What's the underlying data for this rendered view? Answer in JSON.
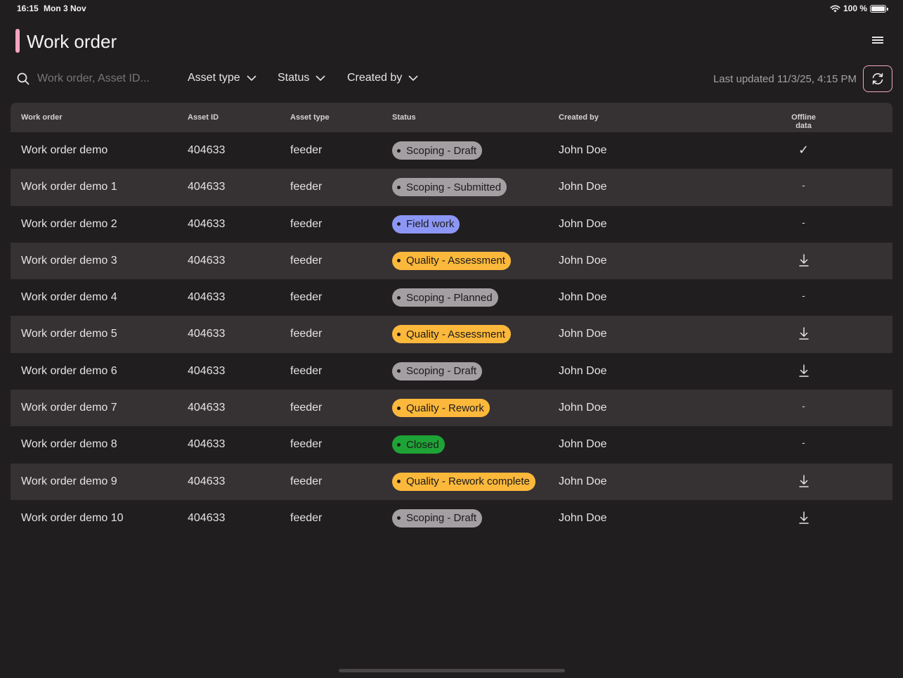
{
  "status_bar": {
    "time": "16:15",
    "date": "Mon 3 Nov",
    "battery": "100 %"
  },
  "header": {
    "title": "Work order",
    "accent_color": "#f7a6bf"
  },
  "toolbar": {
    "search_placeholder": "Work order, Asset ID...",
    "filters": [
      "Asset type",
      "Status",
      "Created by"
    ],
    "last_updated": "Last updated 11/3/25, 4:15 PM"
  },
  "table": {
    "columns": [
      "Work order",
      "Asset ID",
      "Asset type",
      "Status",
      "Created by",
      "Offline data"
    ],
    "rows": [
      {
        "work_order": "Work order demo",
        "asset_id": "404633",
        "asset_type": "feeder",
        "status": "Scoping - Draft",
        "status_color": "grey",
        "created_by": "John Doe",
        "offline": "✓"
      },
      {
        "work_order": "Work order demo 1",
        "asset_id": "404633",
        "asset_type": "feeder",
        "status": "Scoping - Submitted",
        "status_color": "grey",
        "created_by": "John Doe",
        "offline": "-"
      },
      {
        "work_order": "Work order demo 2",
        "asset_id": "404633",
        "asset_type": "feeder",
        "status": "Field work",
        "status_color": "blue",
        "created_by": "John Doe",
        "offline": "-"
      },
      {
        "work_order": "Work order demo 3",
        "asset_id": "404633",
        "asset_type": "feeder",
        "status": "Quality - Assessment",
        "status_color": "yellow",
        "created_by": "John Doe",
        "offline": "download"
      },
      {
        "work_order": "Work order demo 4",
        "asset_id": "404633",
        "asset_type": "feeder",
        "status": "Scoping - Planned",
        "status_color": "grey",
        "created_by": "John Doe",
        "offline": "-"
      },
      {
        "work_order": "Work order demo 5",
        "asset_id": "404633",
        "asset_type": "feeder",
        "status": "Quality - Assessment",
        "status_color": "yellow",
        "created_by": "John Doe",
        "offline": "download"
      },
      {
        "work_order": "Work order demo 6",
        "asset_id": "404633",
        "asset_type": "feeder",
        "status": "Scoping - Draft",
        "status_color": "grey",
        "created_by": "John Doe",
        "offline": "download"
      },
      {
        "work_order": "Work order demo 7",
        "asset_id": "404633",
        "asset_type": "feeder",
        "status": "Quality - Rework",
        "status_color": "yellow",
        "created_by": "John Doe",
        "offline": "-"
      },
      {
        "work_order": "Work order demo 8",
        "asset_id": "404633",
        "asset_type": "feeder",
        "status": "Closed",
        "status_color": "green",
        "created_by": "John Doe",
        "offline": "-"
      },
      {
        "work_order": "Work order demo 9",
        "asset_id": "404633",
        "asset_type": "feeder",
        "status": "Quality - Rework complete",
        "status_color": "yellow",
        "created_by": "John Doe",
        "offline": "download"
      },
      {
        "work_order": "Work order demo 10",
        "asset_id": "404633",
        "asset_type": "feeder",
        "status": "Scoping - Draft",
        "status_color": "grey",
        "created_by": "John Doe",
        "offline": "download"
      }
    ]
  }
}
